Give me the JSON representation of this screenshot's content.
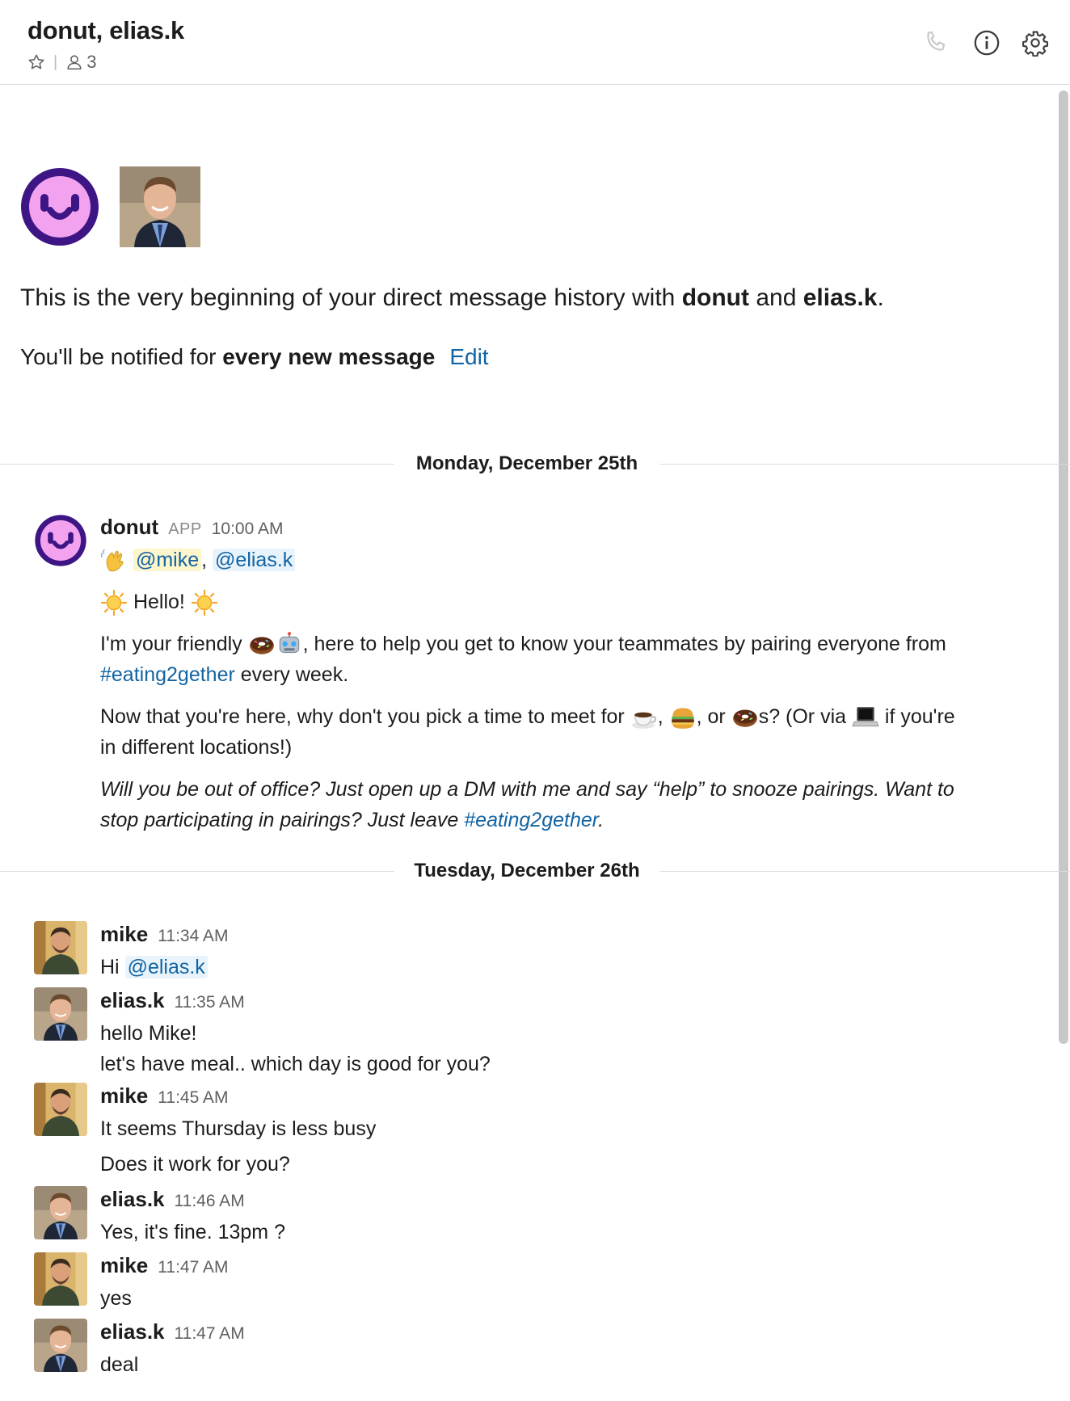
{
  "header": {
    "title": "donut, elias.k",
    "member_count": "3"
  },
  "intro": {
    "text_before": "This is the very beginning of your direct message history with ",
    "name1": "donut",
    "mid": " and ",
    "name2": "elias.k",
    "end": ".",
    "notify_prefix": "You'll be notified for ",
    "notify_bold": "every new message",
    "edit_label": "Edit"
  },
  "days": [
    {
      "label": "Monday, December 25th"
    },
    {
      "label": "Tuesday, December 26th"
    }
  ],
  "donut_msg": {
    "name": "donut",
    "app_badge": "APP",
    "time": "10:00 AM",
    "mention1": "@mike",
    "comma": ",",
    "mention2": "@elias.k",
    "hello": "Hello!",
    "p1_a": "I'm your friendly ",
    "p1_b": ", here to help you get to know your teammates by pairing everyone from ",
    "channel": "#eating2gether",
    "p1_c": " every week.",
    "p2_a": "Now that you're here, why don't you pick a time to meet for ",
    "p2_sep1": ", ",
    "p2_sep2": ", or ",
    "p2_b": "s? (Or via ",
    "p2_c": " if you're in different locations!)",
    "p3_a": "Will you be out of office? Just open up a DM with me and say “help” to snooze pairings. Want to stop participating in pairings? Just leave ",
    "p3_channel": "#eating2gether",
    "p3_end": "."
  },
  "messages": [
    {
      "name": "mike",
      "time": "11:34 AM",
      "prefix": "Hi ",
      "mention": "@elias.k"
    },
    {
      "name": "elias.k",
      "time": "11:35 AM",
      "l1": "hello Mike!",
      "l2": "let's have meal.. which day is good for you?"
    },
    {
      "name": "mike",
      "time": "11:45 AM",
      "l1": "It seems Thursday is less busy",
      "l2": "Does it work for you?"
    },
    {
      "name": "elias.k",
      "time": "11:46 AM",
      "l1": "Yes, it's fine.  13pm ?"
    },
    {
      "name": "mike",
      "time": "11:47 AM",
      "l1": "yes"
    },
    {
      "name": "elias.k",
      "time": "11:47 AM",
      "l1": "deal"
    }
  ],
  "icons": [
    "star-icon",
    "person-icon",
    "phone-icon",
    "info-icon",
    "gear-icon",
    "wave-emoji",
    "sun-emoji",
    "donut-emoji",
    "robot-emoji",
    "coffee-emoji",
    "burger-emoji",
    "laptop-emoji"
  ],
  "colors": {
    "link": "#1264a3",
    "donut_purple": "#4a1a8c",
    "donut_pink": "#f4a6f0"
  }
}
